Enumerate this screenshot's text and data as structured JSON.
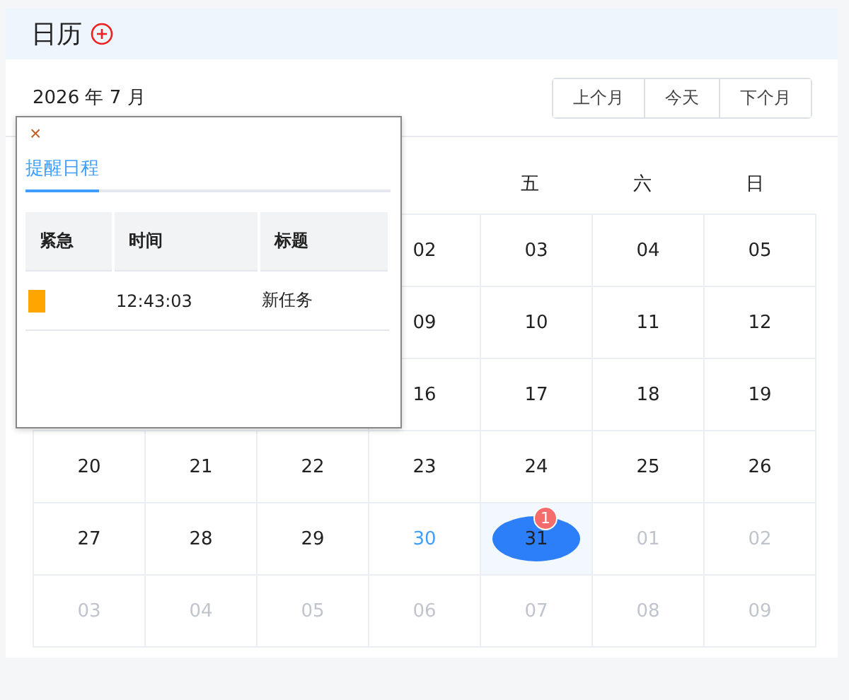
{
  "title": "日历",
  "month_label": "2026 年 7 月",
  "nav_buttons": [
    "上个月",
    "今天",
    "下个月"
  ],
  "weekdays": [
    "五",
    "六",
    "日"
  ],
  "weeks": [
    {
      "cells": [
        {
          "day": "02",
          "muted": false,
          "today": false,
          "selected": false
        },
        {
          "day": "03",
          "muted": false,
          "today": false,
          "selected": false
        },
        {
          "day": "04",
          "muted": false,
          "today": false,
          "selected": false
        },
        {
          "day": "05",
          "muted": false,
          "today": false,
          "selected": false
        }
      ]
    },
    {
      "cells": [
        {
          "day": "09",
          "muted": false,
          "today": false,
          "selected": false
        },
        {
          "day": "10",
          "muted": false,
          "today": false,
          "selected": false
        },
        {
          "day": "11",
          "muted": false,
          "today": false,
          "selected": false
        },
        {
          "day": "12",
          "muted": false,
          "today": false,
          "selected": false
        }
      ]
    },
    {
      "cells": [
        {
          "day": "16",
          "muted": false,
          "today": false,
          "selected": false
        },
        {
          "day": "17",
          "muted": false,
          "today": false,
          "selected": false
        },
        {
          "day": "18",
          "muted": false,
          "today": false,
          "selected": false
        },
        {
          "day": "19",
          "muted": false,
          "today": false,
          "selected": false
        }
      ]
    },
    {
      "cells": [
        {
          "day": "20",
          "muted": false,
          "today": false,
          "selected": false
        },
        {
          "day": "21",
          "muted": false,
          "today": false,
          "selected": false
        },
        {
          "day": "22",
          "muted": false,
          "today": false,
          "selected": false
        },
        {
          "day": "23",
          "muted": false,
          "today": false,
          "selected": false
        },
        {
          "day": "24",
          "muted": false,
          "today": false,
          "selected": false
        },
        {
          "day": "25",
          "muted": false,
          "today": false,
          "selected": false
        },
        {
          "day": "26",
          "muted": false,
          "today": false,
          "selected": false
        }
      ]
    },
    {
      "cells": [
        {
          "day": "27",
          "muted": false,
          "today": false,
          "selected": false
        },
        {
          "day": "28",
          "muted": false,
          "today": false,
          "selected": false
        },
        {
          "day": "29",
          "muted": false,
          "today": false,
          "selected": false
        },
        {
          "day": "30",
          "muted": false,
          "today": true,
          "selected": false
        },
        {
          "day": "31",
          "muted": false,
          "today": false,
          "selected": true,
          "badge": "1"
        },
        {
          "day": "01",
          "muted": true,
          "today": false,
          "selected": false
        },
        {
          "day": "02",
          "muted": true,
          "today": false,
          "selected": false
        }
      ]
    },
    {
      "cells": [
        {
          "day": "03",
          "muted": true,
          "today": false,
          "selected": false
        },
        {
          "day": "04",
          "muted": true,
          "today": false,
          "selected": false
        },
        {
          "day": "05",
          "muted": true,
          "today": false,
          "selected": false
        },
        {
          "day": "06",
          "muted": true,
          "today": false,
          "selected": false
        },
        {
          "day": "07",
          "muted": true,
          "today": false,
          "selected": false
        },
        {
          "day": "08",
          "muted": true,
          "today": false,
          "selected": false
        },
        {
          "day": "09",
          "muted": true,
          "today": false,
          "selected": false
        }
      ]
    }
  ],
  "popup": {
    "close": "×",
    "tabs": [
      {
        "label": "提醒日程",
        "selected": true
      }
    ],
    "columns": [
      "紧急",
      "时间",
      "标题"
    ],
    "rows": [
      {
        "color": "#ffa500",
        "time": "12:43:03",
        "title": "新任务"
      }
    ]
  }
}
